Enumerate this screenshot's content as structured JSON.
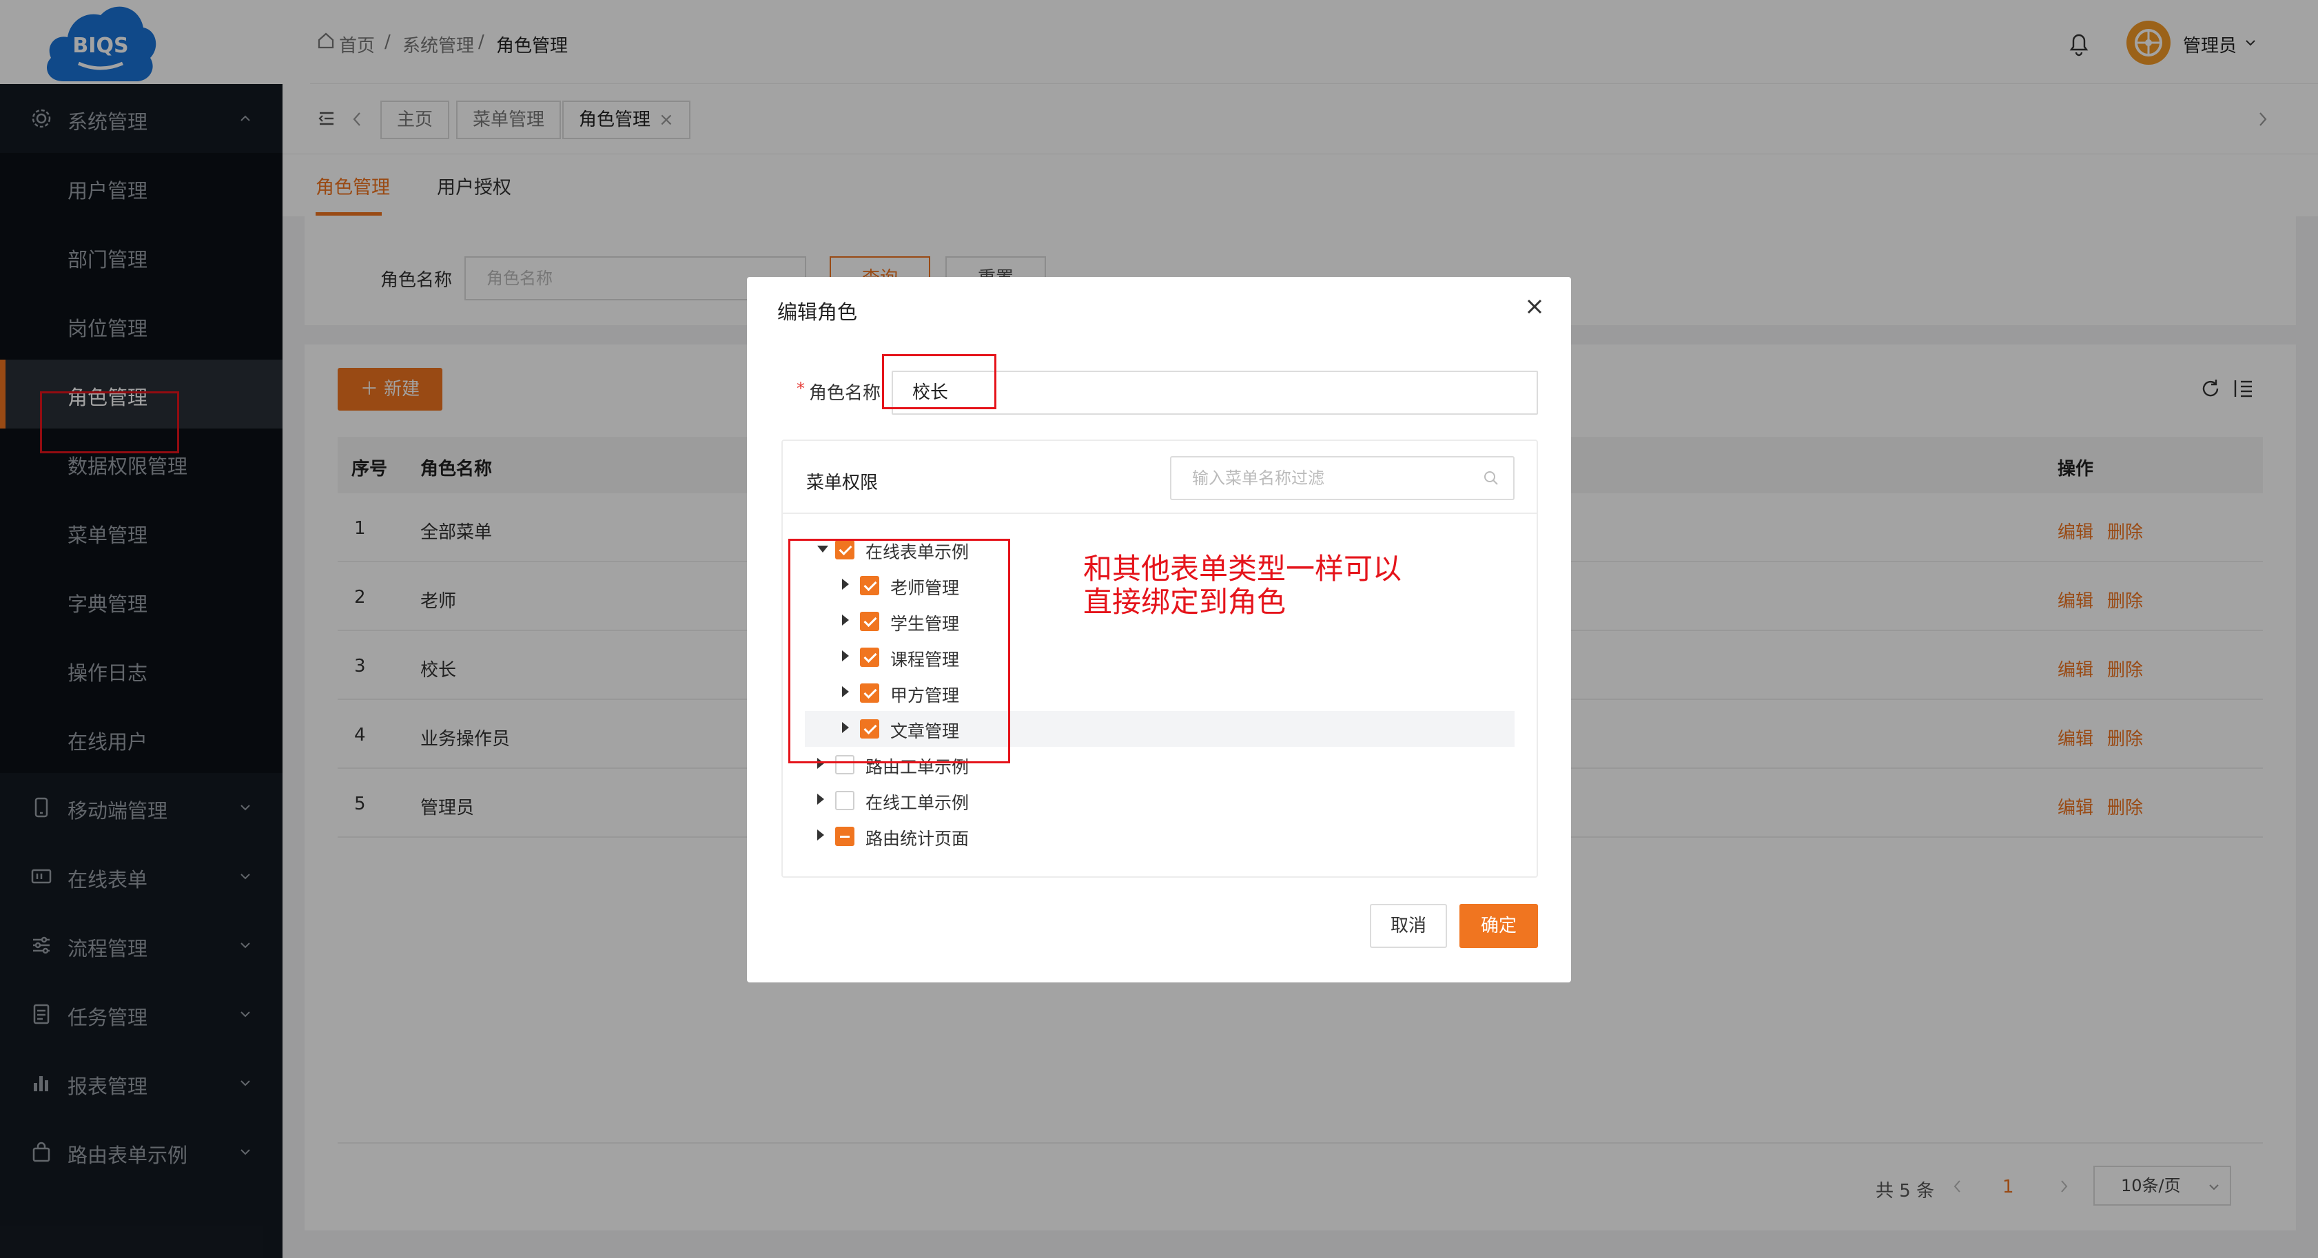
{
  "brand": {
    "logo_text": "BIQS",
    "accent": "#f07520",
    "sidebar_bg": "#141a22"
  },
  "sidebar": {
    "groups": [
      {
        "label": "系统管理",
        "icon": "gear-icon",
        "expanded": true
      },
      {
        "label": "移动端管理",
        "icon": "mobile-icon"
      },
      {
        "label": "在线表单",
        "icon": "form-icon"
      },
      {
        "label": "流程管理",
        "icon": "sliders-icon"
      },
      {
        "label": "任务管理",
        "icon": "task-icon"
      },
      {
        "label": "报表管理",
        "icon": "bar-chart-icon"
      },
      {
        "label": "路由表单示例",
        "icon": "bag-icon"
      }
    ],
    "system_items": [
      {
        "label": "用户管理"
      },
      {
        "label": "部门管理"
      },
      {
        "label": "岗位管理"
      },
      {
        "label": "角色管理",
        "active": true
      },
      {
        "label": "数据权限管理"
      },
      {
        "label": "菜单管理"
      },
      {
        "label": "字典管理"
      },
      {
        "label": "操作日志"
      },
      {
        "label": "在线用户"
      }
    ]
  },
  "header": {
    "breadcrumb": [
      "首页",
      "系统管理",
      "角色管理"
    ],
    "separator": "/",
    "user": "管理员"
  },
  "tags": [
    {
      "label": "主页"
    },
    {
      "label": "菜单管理"
    },
    {
      "label": "角色管理",
      "closable": true,
      "close": "×"
    }
  ],
  "page_tabs": [
    "角色管理",
    "用户授权"
  ],
  "search": {
    "label": "角色名称",
    "placeholder": "角色名称",
    "query": "查询",
    "reset": "重置"
  },
  "table": {
    "new_label": "新建",
    "columns": {
      "index": "序号",
      "name": "角色名称",
      "ops": "操作"
    },
    "rows": [
      {
        "index": "1",
        "name": "全部菜单"
      },
      {
        "index": "2",
        "name": "老师"
      },
      {
        "index": "3",
        "name": "校长"
      },
      {
        "index": "4",
        "name": "业务操作员"
      },
      {
        "index": "5",
        "name": "管理员"
      }
    ],
    "edit": "编辑",
    "delete": "删除"
  },
  "pagination": {
    "total": "共 5 条",
    "page": "1",
    "page_size": "10条/页"
  },
  "modal": {
    "title": "编辑角色",
    "required_mark": "*",
    "name_label": "角色名称",
    "name_value": "校长",
    "tree_title": "菜单权限",
    "filter_placeholder": "输入菜单名称过滤",
    "tree": [
      {
        "label": "在线表单示例",
        "level": 0,
        "expanded": true,
        "state": "checked"
      },
      {
        "label": "老师管理",
        "level": 1,
        "state": "checked"
      },
      {
        "label": "学生管理",
        "level": 1,
        "state": "checked"
      },
      {
        "label": "课程管理",
        "level": 1,
        "state": "checked"
      },
      {
        "label": "甲方管理",
        "level": 1,
        "state": "checked"
      },
      {
        "label": "文章管理",
        "level": 1,
        "state": "checked"
      },
      {
        "label": "路由工单示例",
        "level": 0,
        "state": "unchecked"
      },
      {
        "label": "在线工单示例",
        "level": 0,
        "state": "unchecked"
      },
      {
        "label": "路由统计页面",
        "level": 0,
        "state": "partial"
      }
    ],
    "annotation_line1": "和其他表单类型一样可以",
    "annotation_line2": "直接绑定到角色",
    "cancel": "取消",
    "ok": "确定"
  }
}
